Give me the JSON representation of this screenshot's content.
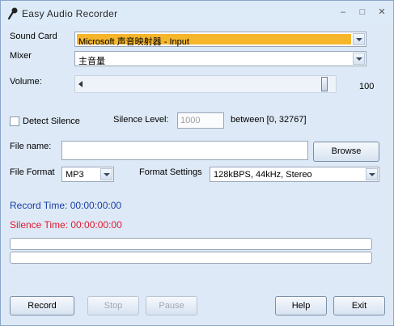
{
  "window": {
    "title": "Easy Audio Recorder",
    "controls": {
      "minimize": "–",
      "maximize": "□",
      "close": "✕"
    }
  },
  "sound_card": {
    "label": "Sound Card",
    "value": "Microsoft 声音映射器 - Input"
  },
  "mixer": {
    "label": "Mixer",
    "value": "主音量"
  },
  "volume": {
    "label": "Volume:",
    "value": "100",
    "level": 1.0
  },
  "detect_silence": {
    "label": "Detect Silence",
    "checked": false
  },
  "silence_level": {
    "label": "Silence Level:",
    "value": "1000",
    "range": "between [0, 32767]"
  },
  "file_name": {
    "label": "File name:",
    "value": "",
    "browse_label": "Browse"
  },
  "file_format": {
    "label": "File Format",
    "value": "MP3"
  },
  "format_settings": {
    "label": "Format Settings",
    "value": "128kBPS, 44kHz, Stereo"
  },
  "record_time": {
    "text": "Record Time: 00:00:00:00",
    "color": "#1b3fa6"
  },
  "silence_time": {
    "text": "Silence Time: 00:00:00:00",
    "color": "#e0192f"
  },
  "buttons": {
    "record": "Record",
    "stop": "Stop",
    "pause": "Pause",
    "help": "Help",
    "exit": "Exit"
  }
}
